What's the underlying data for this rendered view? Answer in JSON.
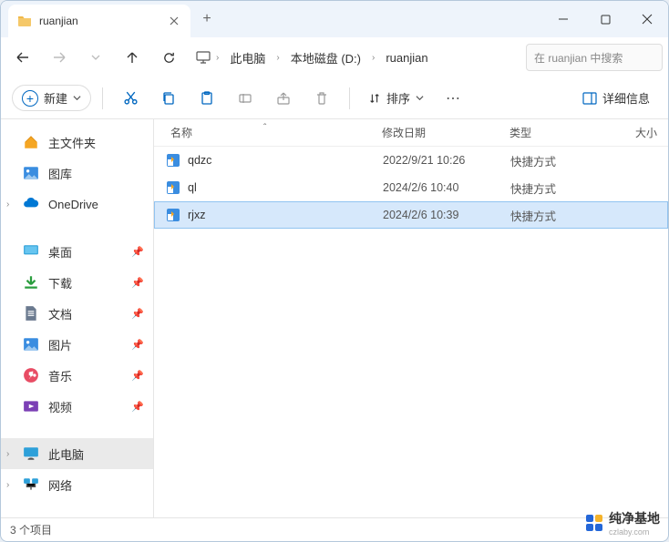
{
  "tab": {
    "title": "ruanjian"
  },
  "breadcrumb": {
    "items": [
      "此电脑",
      "本地磁盘 (D:)",
      "ruanjian"
    ]
  },
  "search": {
    "placeholder": "在 ruanjian 中搜索"
  },
  "toolbar": {
    "new_label": "新建",
    "sort_label": "排序",
    "details_label": "详细信息"
  },
  "sidebar": {
    "home": "主文件夹",
    "gallery": "图库",
    "onedrive": "OneDrive",
    "desktop": "桌面",
    "downloads": "下载",
    "documents": "文档",
    "pictures": "图片",
    "music": "音乐",
    "videos": "视频",
    "thispc": "此电脑",
    "network": "网络"
  },
  "columns": {
    "name": "名称",
    "modified": "修改日期",
    "type": "类型",
    "size": "大小"
  },
  "files": [
    {
      "name": "qdzc",
      "date": "2022/9/21 10:26",
      "type": "快捷方式",
      "selected": false
    },
    {
      "name": "ql",
      "date": "2024/2/6 10:40",
      "type": "快捷方式",
      "selected": false
    },
    {
      "name": "rjxz",
      "date": "2024/2/6 10:39",
      "type": "快捷方式",
      "selected": true
    }
  ],
  "status": {
    "count": "3 个项目"
  },
  "watermark": {
    "brand": "纯净基地",
    "url": "czlaby.com"
  }
}
